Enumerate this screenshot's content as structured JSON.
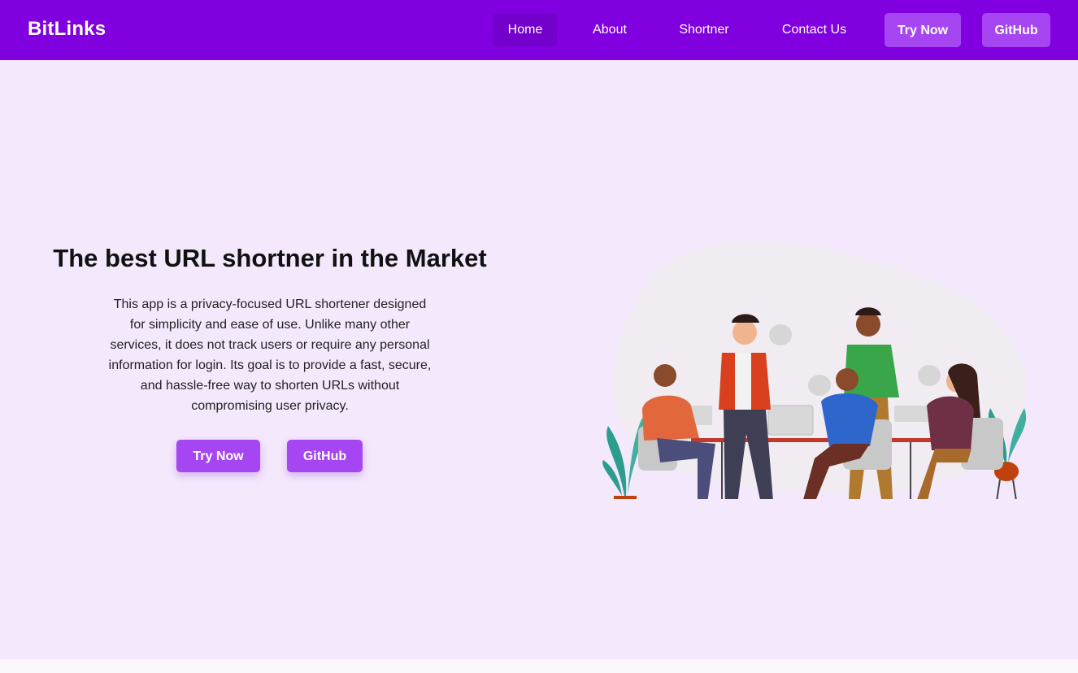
{
  "brand": {
    "name": "BitLinks"
  },
  "nav": {
    "links": [
      "Home",
      "About",
      "Shortner",
      "Contact Us"
    ],
    "active": "Home",
    "try_now_label": "Try Now",
    "github_label": "GitHub"
  },
  "hero": {
    "title": "The best URL shortner in the Market",
    "description": "This app is a privacy-focused URL shortener designed for simplicity and ease of use. Unlike many other services, it does not track users or require any personal information for login. Its goal is to provide a fast, secure, and hassle-free way to shorten URLs without compromising user privacy.",
    "try_now_label": "Try Now",
    "github_label": "GitHub"
  },
  "colors": {
    "navbar": "#8000e0",
    "accent_button": "#a646f3",
    "hero_background": "#f4e8fd"
  },
  "illustration": {
    "icon": "team-meeting-illustration"
  }
}
